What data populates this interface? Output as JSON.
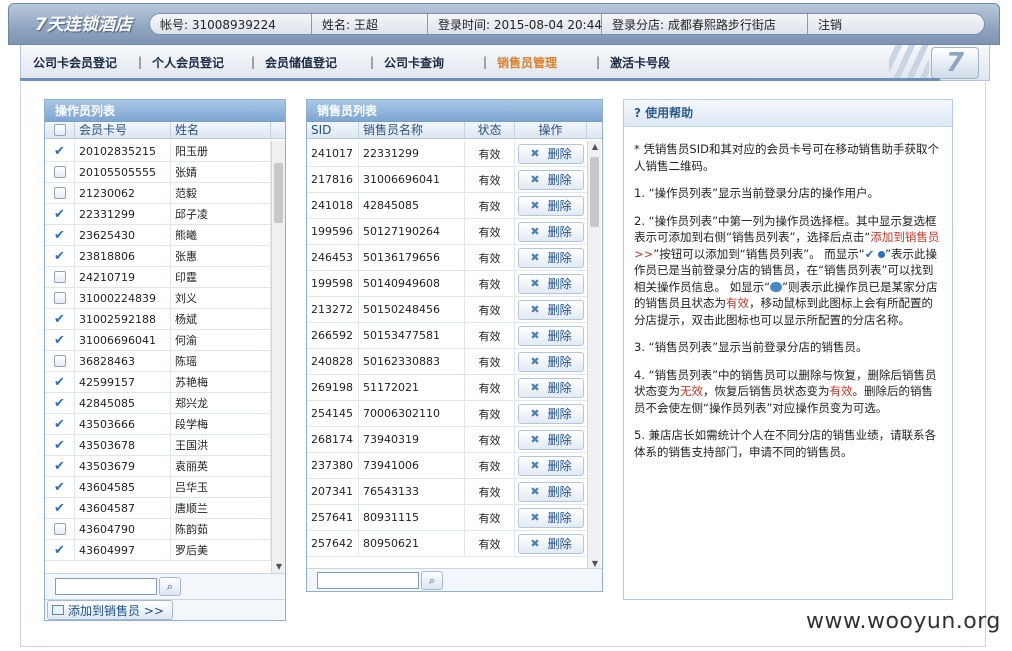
{
  "header": {
    "logo": "7天连锁酒店",
    "account": "帐号: 31008939224",
    "name": "姓名: 王超",
    "login_time": "登录时间: 2015-08-04 20:44",
    "branch": "登录分店: 成都春熙路步行街店",
    "logout": "注销"
  },
  "nav": {
    "items": [
      "公司卡会员登记",
      "个人会员登记",
      "会员储值登记",
      "公司卡查询",
      "销售员管理",
      "激活卡号段"
    ],
    "active_index": 4,
    "logo_seven": "7"
  },
  "operator_panel": {
    "title": "操作员列表",
    "col_card": "会员卡号",
    "col_name": "姓名",
    "rows": [
      {
        "checked": true,
        "card": "20102835215",
        "name": "阳玉册"
      },
      {
        "checked": false,
        "card": "20105505555",
        "name": "张婧"
      },
      {
        "checked": false,
        "card": "21230062",
        "name": "范毅"
      },
      {
        "checked": true,
        "card": "22331299",
        "name": "邱子凌"
      },
      {
        "checked": true,
        "card": "23625430",
        "name": "熊曦"
      },
      {
        "checked": true,
        "card": "23818806",
        "name": "张惠"
      },
      {
        "checked": false,
        "card": "24210719",
        "name": "印霆"
      },
      {
        "checked": false,
        "card": "31000224839",
        "name": "刘义"
      },
      {
        "checked": true,
        "card": "31002592188",
        "name": "杨斌"
      },
      {
        "checked": true,
        "card": "31006696041",
        "name": "何渝"
      },
      {
        "checked": false,
        "card": "36828463",
        "name": "陈瑶"
      },
      {
        "checked": true,
        "card": "42599157",
        "name": "苏艳梅"
      },
      {
        "checked": true,
        "card": "42845085",
        "name": "郑兴龙"
      },
      {
        "checked": true,
        "card": "43503666",
        "name": "段学梅"
      },
      {
        "checked": true,
        "card": "43503678",
        "name": "王国洪"
      },
      {
        "checked": true,
        "card": "43503679",
        "name": "袁丽英"
      },
      {
        "checked": true,
        "card": "43604585",
        "name": "吕华玉"
      },
      {
        "checked": true,
        "card": "43604587",
        "name": "唐顺兰"
      },
      {
        "checked": false,
        "card": "43604790",
        "name": "陈韵茹"
      },
      {
        "checked": true,
        "card": "43604997",
        "name": "罗后美"
      }
    ],
    "add_button": "添加到销售员 >>"
  },
  "sales_panel": {
    "title": "销售员列表",
    "col_sid": "SID",
    "col_name": "销售员名称",
    "col_status": "状态",
    "col_op": "操作",
    "delete_label": "删除",
    "rows": [
      {
        "sid": "241017",
        "name": "22331299",
        "status": "有效"
      },
      {
        "sid": "217816",
        "name": "31006696041",
        "status": "有效"
      },
      {
        "sid": "241018",
        "name": "42845085",
        "status": "有效"
      },
      {
        "sid": "199596",
        "name": "50127190264",
        "status": "有效"
      },
      {
        "sid": "246453",
        "name": "50136179656",
        "status": "有效"
      },
      {
        "sid": "199598",
        "name": "50140949608",
        "status": "有效"
      },
      {
        "sid": "213272",
        "name": "50150248456",
        "status": "有效"
      },
      {
        "sid": "266592",
        "name": "50153477581",
        "status": "有效"
      },
      {
        "sid": "240828",
        "name": "50162330883",
        "status": "有效"
      },
      {
        "sid": "269198",
        "name": "51172021",
        "status": "有效"
      },
      {
        "sid": "254145",
        "name": "70006302110",
        "status": "有效"
      },
      {
        "sid": "268174",
        "name": "73940319",
        "status": "有效"
      },
      {
        "sid": "237380",
        "name": "73941006",
        "status": "有效"
      },
      {
        "sid": "207341",
        "name": "76543133",
        "status": "有效"
      },
      {
        "sid": "257641",
        "name": "80931115",
        "status": "有效"
      },
      {
        "sid": "257642",
        "name": "80950621",
        "status": "有效"
      }
    ]
  },
  "help": {
    "title": "? 使用帮助",
    "p0": "* 凭销售员SID和其对应的会员卡号可在移动销售助手获取个人销售二维码。",
    "p1": "1. “操作员列表”显示当前登录分店的操作用户。",
    "p2a": "2. “操作员列表”中第一列为操作员选择框。其中显示复选框表示可添加到右侧“销售员列表”，选择后点击“",
    "p2_link": "添加到销售员 >>",
    "p2b": "”按钮可以添加到“销售员列表”。 而显示“",
    "p2c": "”表示此操作员已是当前登录分店的销售员，在“销售员列表”可以找到相关操作员信息。 如显示“",
    "p2d": "”则表示此操作员已是某家分店的销售员且状态为",
    "p2_valid": "有效",
    "p2e": "，移动鼠标到此图标上会有所配置的分店提示，双击此图标也可以显示所配置的分店名称。",
    "p3": "3. “销售员列表”显示当前登录分店的销售员。",
    "p4a": "4. “销售员列表”中的销售员可以删除与恢复，删除后销售员状态变为",
    "p4_invalid": "无效",
    "p4b": "，恢复后销售员状态变为",
    "p4_valid": "有效",
    "p4c": "。删除后的销售员不会使左侧“操作员列表”对应操作员变为可选。",
    "p5": "5. 兼店店长如需统计个人在不同分店的销售业绩，请联系各体系的销售支持部门，申请不同的销售员。"
  },
  "watermark": "www.wooyun.org"
}
